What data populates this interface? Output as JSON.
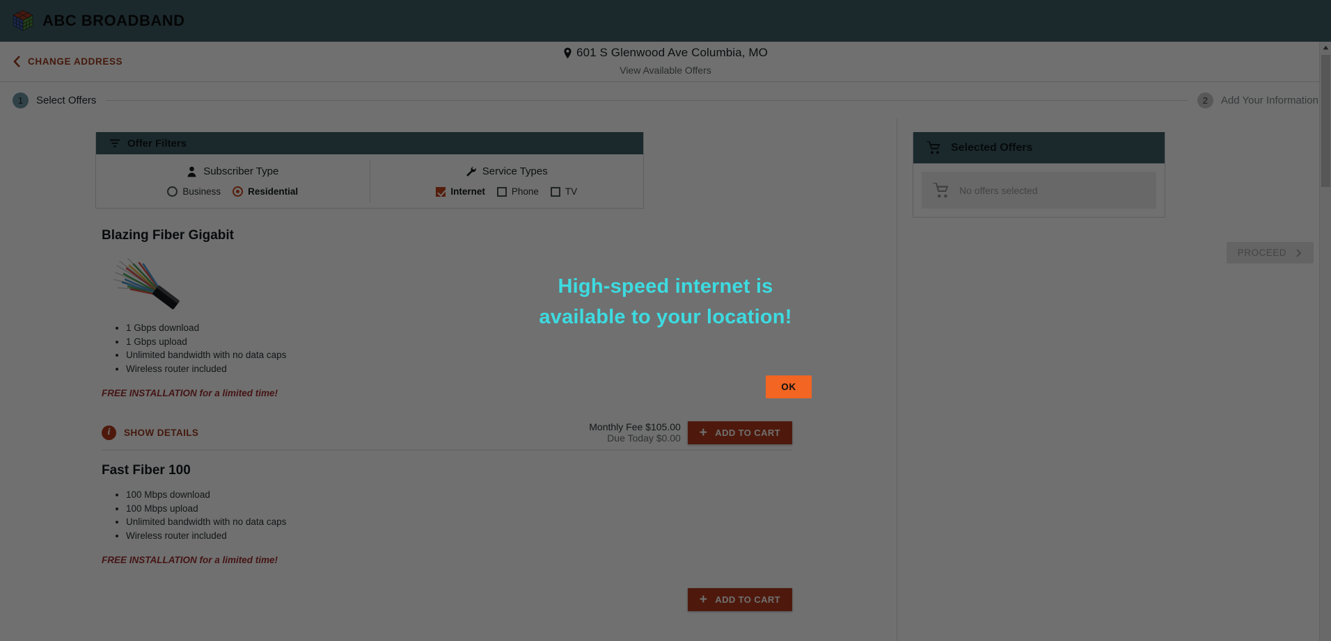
{
  "brand": {
    "name": "ABC BROADBAND",
    "logo_icon": "cube-logo-icon",
    "bar_color": "#3f5d66"
  },
  "address_bar": {
    "change_address_label": "CHANGE ADDRESS",
    "back_icon": "chevron-left-icon",
    "pin_icon": "map-pin-icon",
    "address": "601 S Glenwood Ave Columbia, MO",
    "subtitle": "View Available Offers"
  },
  "stepper": {
    "steps": [
      {
        "number": "1",
        "label": "Select Offers",
        "state": "active"
      },
      {
        "number": "2",
        "label": "Add Your Information",
        "state": "inactive"
      }
    ]
  },
  "filters": {
    "header": {
      "title": "Offer Filters",
      "icon": "filter-icon"
    },
    "subscriber_type": {
      "title": "Subscriber Type",
      "icon": "person-icon",
      "options": [
        {
          "label": "Business",
          "selected": false
        },
        {
          "label": "Residential",
          "selected": true
        }
      ]
    },
    "service_types": {
      "title": "Service Types",
      "icon": "wrench-icon",
      "options": [
        {
          "label": "Internet",
          "checked": true
        },
        {
          "label": "Phone",
          "checked": false
        },
        {
          "label": "TV",
          "checked": false
        }
      ]
    }
  },
  "offers": [
    {
      "title": "Blazing Fiber Gigabit",
      "image_icon": "fiber-optic-cable-image",
      "features": [
        "1 Gbps download",
        "1 Gbps upload",
        "Unlimited bandwidth with no data caps",
        "Wireless router included"
      ],
      "promo": "FREE INSTALLATION for a limited time!",
      "show_details_label": "SHOW DETAILS",
      "show_details_icon": "info-icon",
      "monthly_fee": "Monthly Fee $105.00",
      "due_today": "Due Today $0.00",
      "add_to_cart_label": "ADD TO CART",
      "add_to_cart_icon": "plus-icon"
    },
    {
      "title": "Fast Fiber 100",
      "features": [
        "100 Mbps download",
        "100 Mbps upload",
        "Unlimited bandwidth with no data caps",
        "Wireless router included"
      ],
      "promo": "FREE INSTALLATION for a limited time!"
    }
  ],
  "cart": {
    "header": {
      "title": "Selected Offers",
      "icon": "shopping-cart-icon"
    },
    "empty_text": "No offers selected",
    "empty_icon": "shopping-cart-icon",
    "proceed_label": "PROCEED",
    "proceed_icon": "chevron-right-icon"
  },
  "modal": {
    "title_line1": "High-speed internet is",
    "title_line2": "available to your location!",
    "ok_label": "OK",
    "title_color": "#3ddbe0",
    "ok_color": "#f26522"
  },
  "colors": {
    "brand_teal": "#3f5d66",
    "accent_orange": "#b23a1d",
    "promo_red": "#9d2f30"
  }
}
